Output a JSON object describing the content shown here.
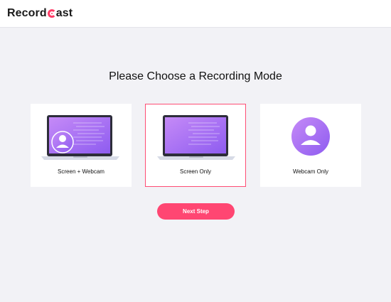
{
  "app": {
    "logo_prefix": "Record",
    "logo_suffix": "ast"
  },
  "heading": "Please Choose a Recording Mode",
  "modes": [
    {
      "label": "Screen + Webcam",
      "selected": false,
      "icon": "laptop-with-avatar-icon"
    },
    {
      "label": "Screen Only",
      "selected": true,
      "icon": "laptop-icon"
    },
    {
      "label": "Webcam Only",
      "selected": false,
      "icon": "avatar-circle-icon"
    }
  ],
  "next_button": "Next Step",
  "colors": {
    "accent": "#ff4672",
    "background": "#f2f2f6",
    "screen_gradient_start": "#c58af7",
    "screen_gradient_end": "#8e5cf0"
  }
}
